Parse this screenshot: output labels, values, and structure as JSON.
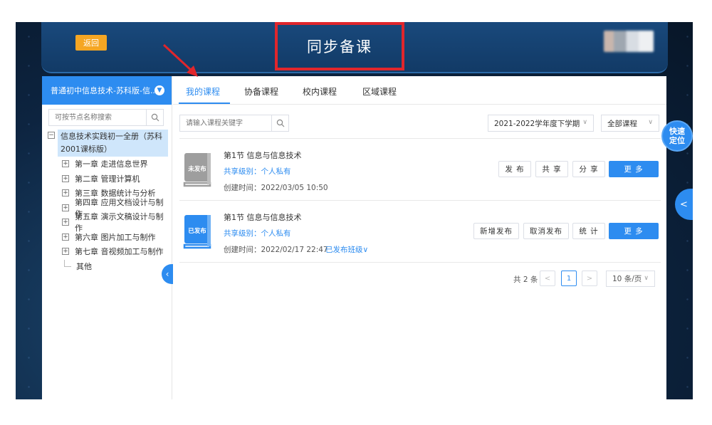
{
  "header": {
    "back_label": "返回",
    "title": "同步备课"
  },
  "sidebar": {
    "course_name": "普通初中信息技术-苏科版-信...",
    "search_placeholder": "可按节点名称搜索",
    "root_label": "信息技术实践初一全册（苏科2001课标版）",
    "chapters": [
      "第一章 走进信息世界",
      "第二章 管理计算机",
      "第三章 数据统计与分析",
      "第四章 应用文档设计与制作",
      "第五章 演示文稿设计与制作",
      "第六章 图片加工与制作",
      "第七章 音视频加工与制作"
    ],
    "other_label": "其他"
  },
  "tabs": [
    "我的课程",
    "协备课程",
    "校内课程",
    "区域课程"
  ],
  "filters": {
    "search_placeholder": "请输入课程关键字",
    "term": "2021-2022学年度下学期",
    "category": "全部课程"
  },
  "courses": [
    {
      "status": "未发布",
      "title": "第1节 信息与信息技术",
      "share": "共享级别：个人私有",
      "created": "创建时间：2022/03/05 10:50",
      "buttons": [
        "发 布",
        "共 享",
        "分 享",
        "更 多"
      ]
    },
    {
      "status": "已发布",
      "title": "第1节 信息与信息技术",
      "share": "共享级别：个人私有",
      "created": "创建时间：2022/02/17 22:47",
      "published_classes": "已发布班级∨",
      "buttons": [
        "新增发布",
        "取消发布",
        "统 计",
        "更 多"
      ]
    }
  ],
  "pagination": {
    "total": "共 2 条",
    "prev": "<",
    "current_page": "1",
    "next": ">",
    "page_size": "10 条/页"
  },
  "floating": {
    "quick_locate_line1": "快速",
    "quick_locate_line2": "定位",
    "expand_arrow": "<"
  },
  "colors": {
    "primary": "#2d8cf0",
    "back_button": "#f5a623",
    "highlight_box": "#e0262c",
    "unpublished_book": "#9e9e9e",
    "published_book": "#2d8cf0"
  }
}
